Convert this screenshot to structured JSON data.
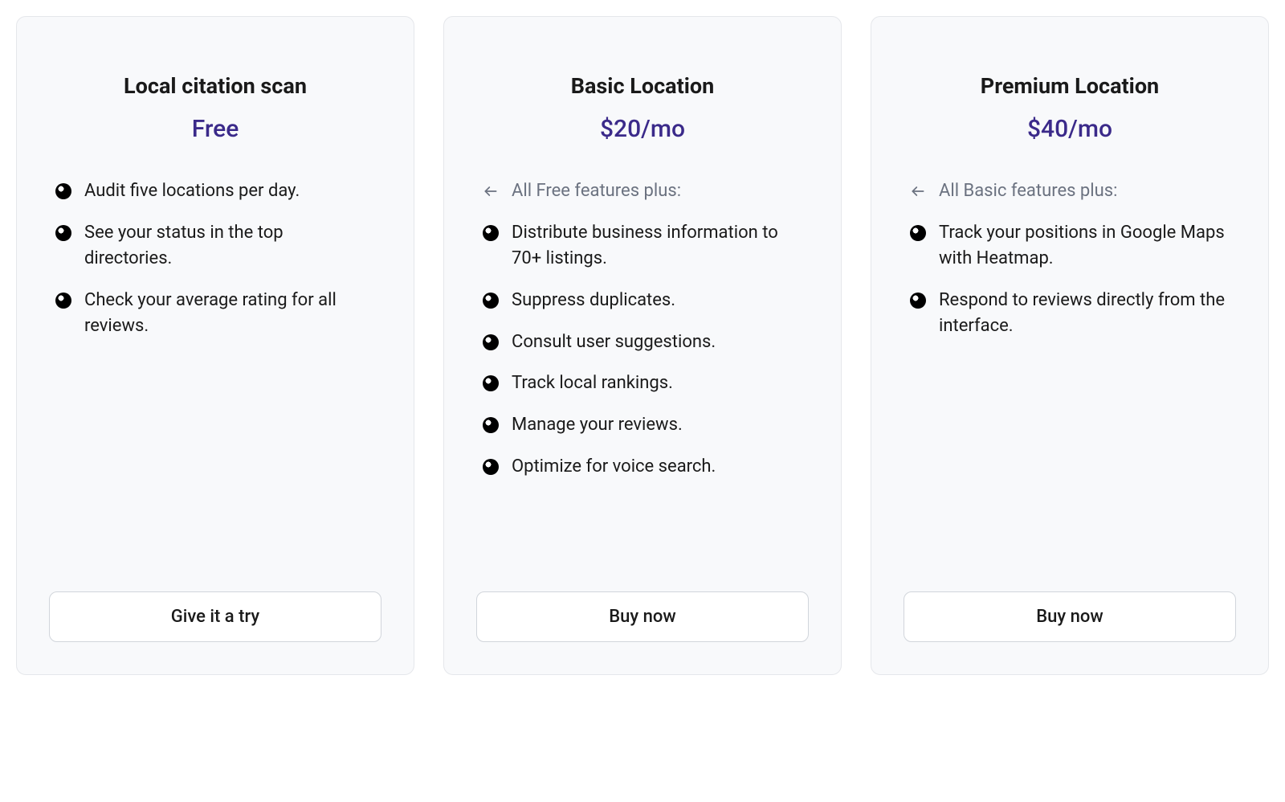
{
  "plans": [
    {
      "title": "Local citation scan",
      "price": "Free",
      "inherit": null,
      "features": [
        "Audit five locations per day.",
        "See your status in the top directories.",
        "Check your average rating for all reviews."
      ],
      "cta": "Give it a try"
    },
    {
      "title": "Basic Location",
      "price": "$20/mo",
      "inherit": "All Free features plus:",
      "features": [
        "Distribute business information to 70+ listings.",
        "Suppress duplicates.",
        "Consult user suggestions.",
        "Track local rankings.",
        "Manage your reviews.",
        "Optimize for voice search."
      ],
      "cta": "Buy now"
    },
    {
      "title": "Premium Location",
      "price": "$40/mo",
      "inherit": "All Basic features plus:",
      "features": [
        "Track your positions in Google Maps with Heatmap.",
        "Respond to reviews directly from the interface."
      ],
      "cta": "Buy now"
    }
  ]
}
